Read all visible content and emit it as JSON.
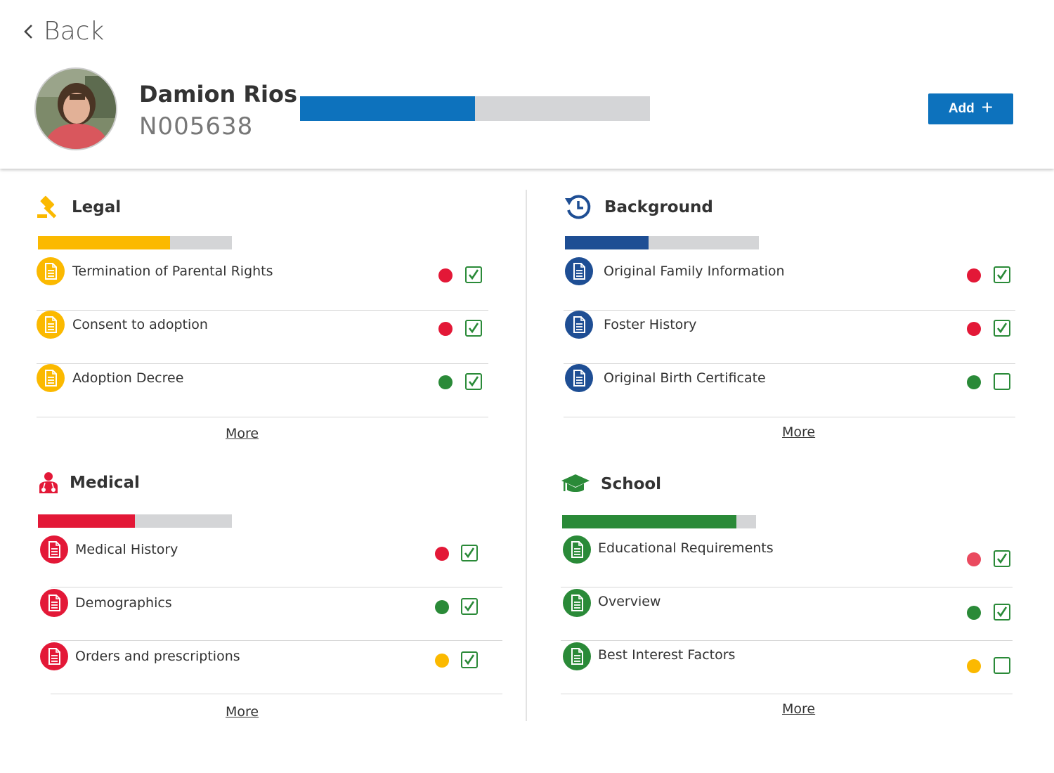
{
  "header": {
    "back_label": "Back",
    "name": "Damion Rios",
    "id": "N005638",
    "progress": 0.5,
    "progress_color": "#0d72bd",
    "add_label": "Add",
    "add_icon": "plus-icon"
  },
  "sections": {
    "legal": {
      "title": "Legal",
      "icon": "gavel-icon",
      "color": "#fbb900",
      "progress": 0.68,
      "more_label": "More",
      "items": [
        {
          "label": "Termination of Parental Rights",
          "status": "#e31837",
          "checked": true
        },
        {
          "label": "Consent to adoption",
          "status": "#e31837",
          "checked": true
        },
        {
          "label": "Adoption Decree",
          "status": "#2a8a38",
          "checked": true
        }
      ]
    },
    "background": {
      "title": "Background",
      "icon": "history-icon",
      "color": "#1e4e94",
      "progress": 0.43,
      "more_label": "More",
      "items": [
        {
          "label": "Original Family Information",
          "status": "#e31837",
          "checked": true
        },
        {
          "label": "Foster History",
          "status": "#e31837",
          "checked": true
        },
        {
          "label": "Original Birth Certificate",
          "status": "#2a8a38",
          "checked": false
        }
      ]
    },
    "medical": {
      "title": "Medical",
      "icon": "doctor-icon",
      "color": "#e31837",
      "progress": 0.5,
      "more_label": "More",
      "items": [
        {
          "label": "Medical History",
          "status": "#e31837",
          "checked": true
        },
        {
          "label": "Demographics",
          "status": "#2a8a38",
          "checked": true
        },
        {
          "label": "Orders and prescriptions",
          "status": "#fbb900",
          "checked": true
        }
      ]
    },
    "school": {
      "title": "School",
      "icon": "graduation-cap-icon",
      "color": "#2a8a38",
      "progress": 0.9,
      "more_label": "More",
      "items": [
        {
          "label": "Educational Requirements",
          "status": "#ea4a5f",
          "checked": true
        },
        {
          "label": "Overview",
          "status": "#2a8a38",
          "checked": true
        },
        {
          "label": "Best Interest Factors",
          "status": "#fbb900",
          "checked": false
        }
      ]
    }
  }
}
